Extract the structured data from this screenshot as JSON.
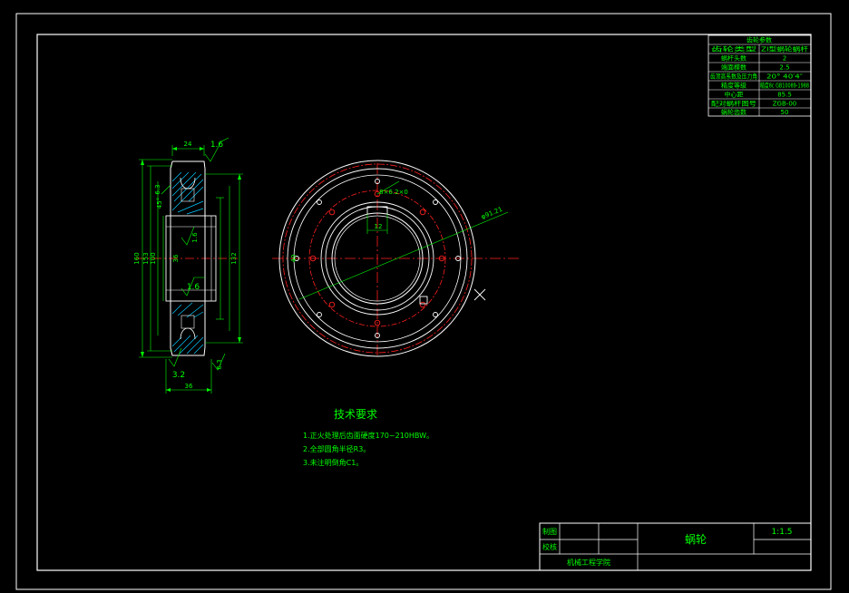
{
  "params_table": {
    "title": "齿轮参数",
    "rows": [
      [
        "齿轮类型",
        "ZI型蜗轮蜗杆"
      ],
      [
        "蜗杆头数",
        "2"
      ],
      [
        "端面模数",
        "2.5"
      ],
      [
        "齿顶高系数及压力角",
        "20° 40′4″"
      ],
      [
        "精度等级",
        "精度8c GB10089-1988"
      ],
      [
        "中心距",
        "85.5"
      ],
      [
        "配对蜗杆图号",
        "ZGB-00"
      ],
      [
        "蜗轮齿数",
        "50"
      ]
    ]
  },
  "side_view": {
    "dims": {
      "top_width": "24",
      "rough_top": "1.6",
      "rough_left": "6.3",
      "rough_bore": "1.6",
      "rough_mid": "1.6",
      "angle": "45°",
      "dia_outer": "160",
      "dia_mid": "153",
      "dia_hub": "100",
      "dia_bore": "36",
      "dia_right": "132",
      "rough_bottom": "3.2",
      "rough_br": "6.3",
      "bottom_width": "36"
    }
  },
  "front_view": {
    "hole_label": "8×6.2×0",
    "radius_label": "φ91.21",
    "key_width": "12",
    "bore_label": "40"
  },
  "tech_req": {
    "title": "技术要求",
    "lines": [
      "1.正火处理后齿面硬度170~210HBW。",
      "2.全部圆角半径R3。",
      "3.未注明倒角C1。"
    ]
  },
  "title_block": {
    "drawn_label": "制图",
    "check_label": "校核",
    "part_name": "蜗轮",
    "scale": "1:1.5",
    "school": "机械工程学院"
  }
}
